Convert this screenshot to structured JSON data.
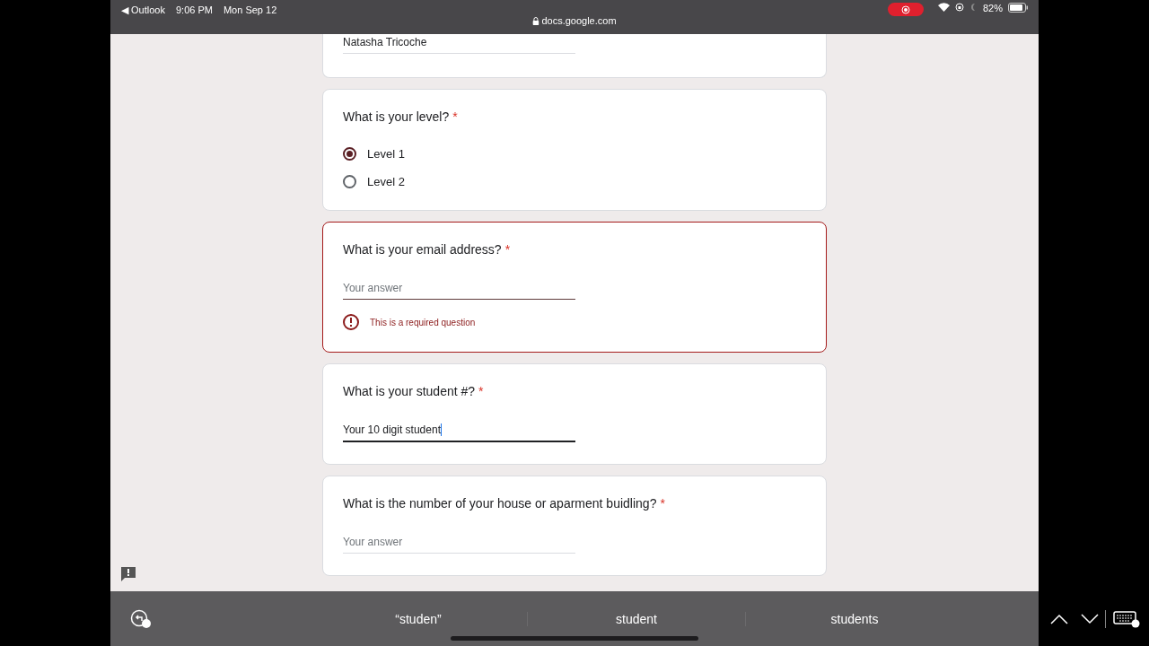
{
  "status_bar": {
    "back_app": "◀ Outlook",
    "time": "9:06 PM",
    "date": "Mon Sep 12",
    "url": "docs.google.com",
    "battery": "82%",
    "recording": true
  },
  "form": {
    "questions": [
      {
        "kind": "text",
        "value": "Natasha Tricoche",
        "focused": false
      },
      {
        "kind": "radio",
        "title": "What is your level?",
        "required_mark": "*",
        "options": [
          {
            "label": "Level 1",
            "selected": true
          },
          {
            "label": "Level 2",
            "selected": false
          }
        ]
      },
      {
        "kind": "text",
        "title": "What is your email address?",
        "required_mark": "*",
        "placeholder": "Your answer",
        "error": "This is a required question",
        "focused": false
      },
      {
        "kind": "text",
        "title": "What is your student #?",
        "required_mark": "*",
        "value": "Your 10 digit student",
        "focused": true
      },
      {
        "kind": "text",
        "title": "What is the number of your house or aparment buidling?",
        "required_mark": "*",
        "placeholder": "Your answer",
        "focused": false
      }
    ]
  },
  "keyboard_bar": {
    "suggestions": [
      "“studen”",
      "student",
      "students"
    ]
  }
}
